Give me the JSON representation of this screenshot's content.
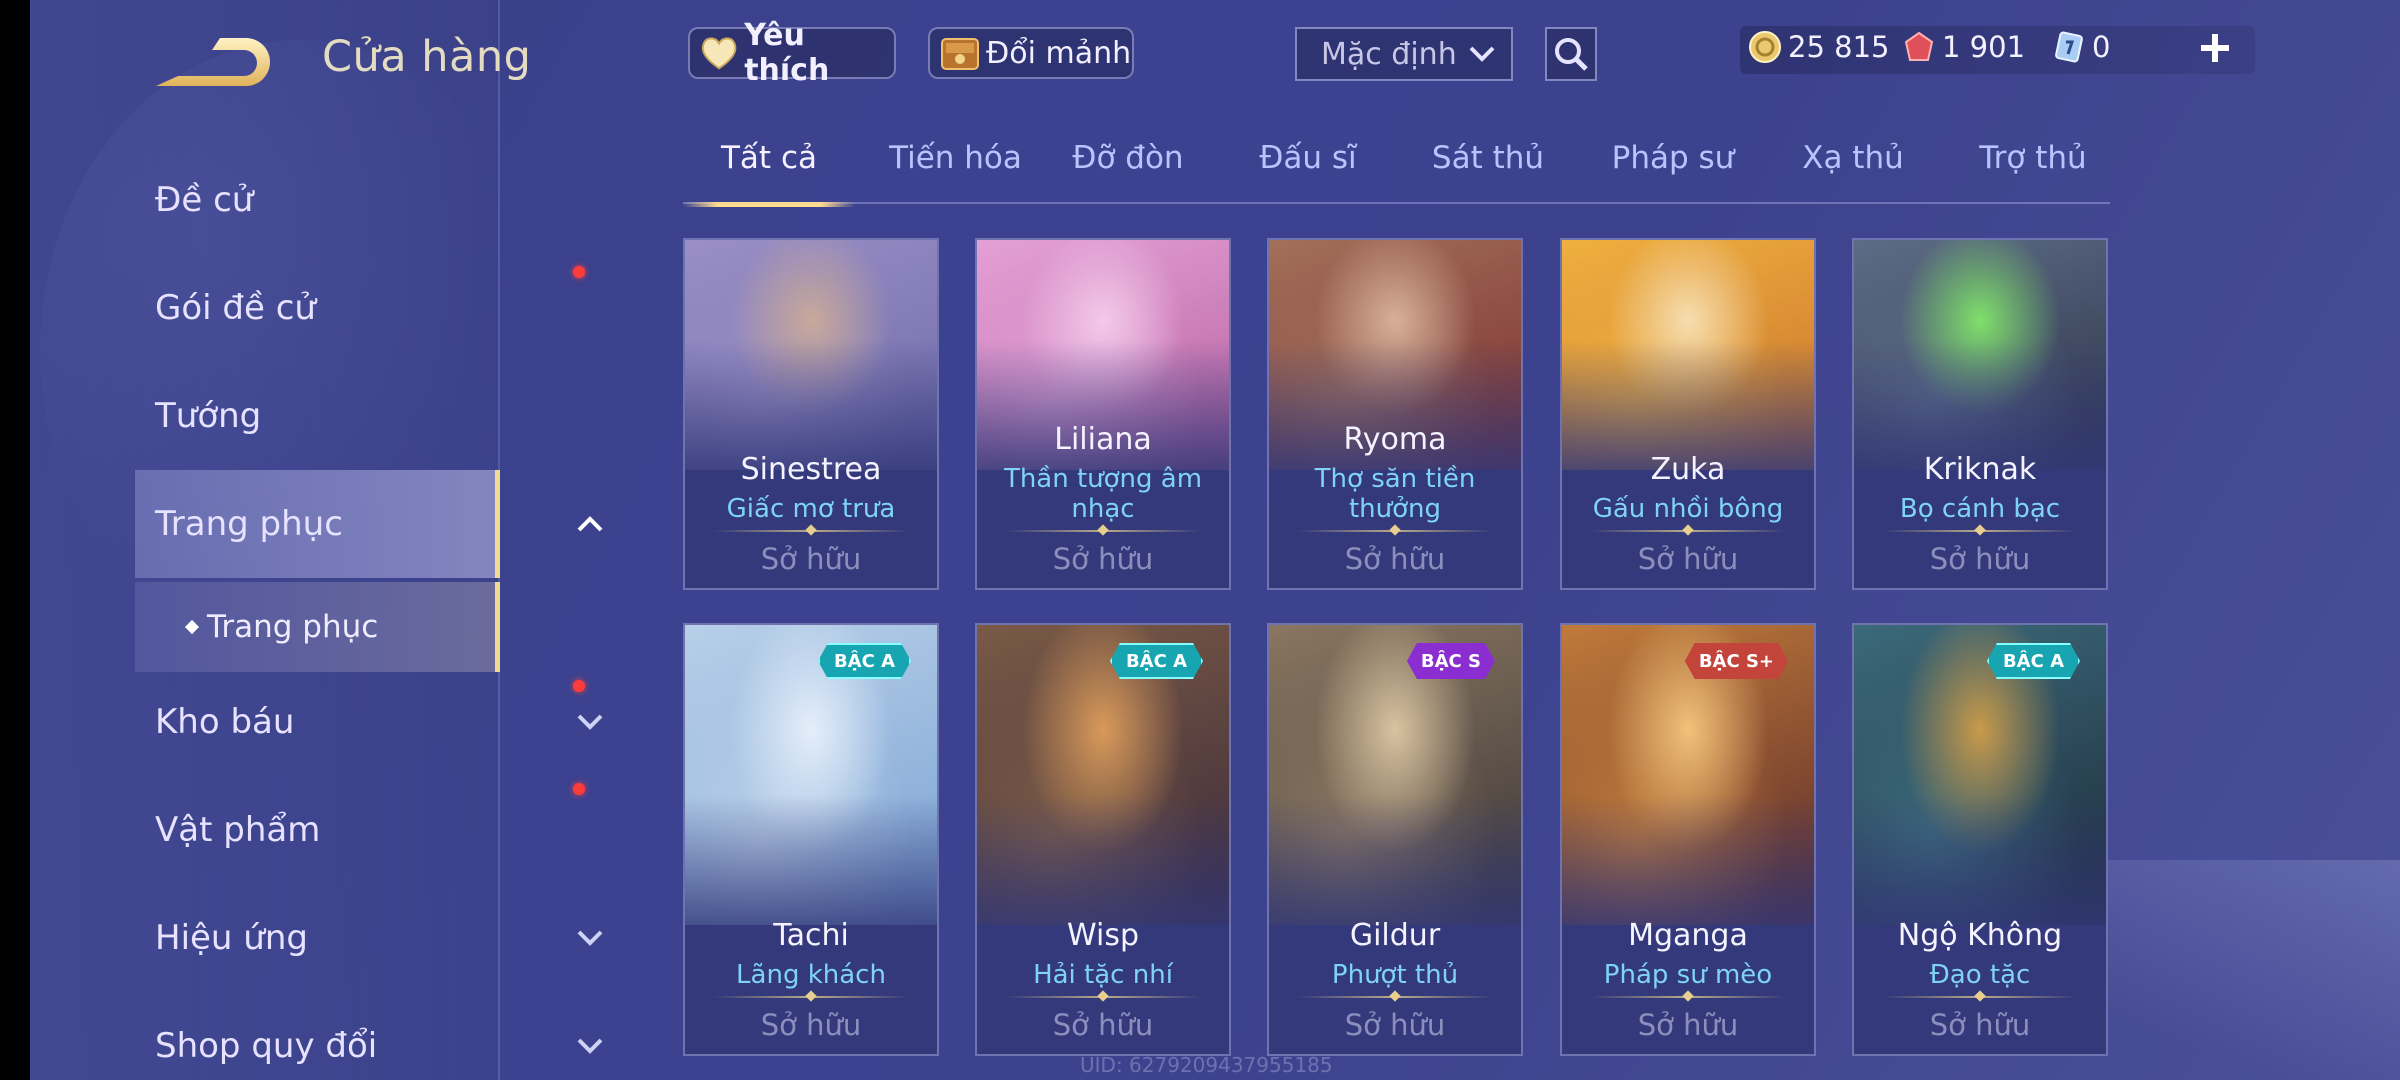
{
  "header": {
    "title": "Cửa hàng",
    "favorite_label": "Yêu thích",
    "exchange_label": "Đổi mảnh",
    "sort_value": "Mặc định"
  },
  "currencies": {
    "gold": "25 815",
    "ruby": "1 901",
    "tickets": "0"
  },
  "sidebar": {
    "items": [
      {
        "label": "Đề cử"
      },
      {
        "label": "Gói đề cử"
      },
      {
        "label": "Tướng"
      },
      {
        "label": "Trang phục"
      },
      {
        "label": "Kho báu"
      },
      {
        "label": "Vật phẩm"
      },
      {
        "label": "Hiệu ứng"
      },
      {
        "label": "Shop quy đổi"
      }
    ],
    "sub_item": "Trang phục"
  },
  "tabs": [
    "Tất cả",
    "Tiến hóa",
    "Đỡ đòn",
    "Đấu sĩ",
    "Sát thủ",
    "Pháp sư",
    "Xạ thủ",
    "Trợ thủ"
  ],
  "cards": [
    {
      "hero": "Sinestrea",
      "skin": "Giấc mơ trưa",
      "status": "Sở hữu",
      "badge": "",
      "colors": [
        "#9a8fc6",
        "#6d6aa8",
        "#c9a99a"
      ]
    },
    {
      "hero": "Liliana",
      "skin": "Thần tượng âm nhạc",
      "status": "Sở hữu",
      "badge": "",
      "colors": [
        "#e4a1d6",
        "#b6609e",
        "#f3c9ea"
      ]
    },
    {
      "hero": "Ryoma",
      "skin": "Thợ săn tiền thưởng",
      "status": "Sở hữu",
      "badge": "",
      "colors": [
        "#a2705a",
        "#7c2e2e",
        "#d7b09a"
      ]
    },
    {
      "hero": "Zuka",
      "skin": "Gấu nhồi bông",
      "status": "Sở hữu",
      "badge": "",
      "colors": [
        "#f0b040",
        "#c8722a",
        "#f6deb0"
      ]
    },
    {
      "hero": "Kriknak",
      "skin": "Bọ cánh bạc",
      "status": "Sở hữu",
      "badge": "",
      "colors": [
        "#5d6c86",
        "#2c3448",
        "#7fe06a"
      ]
    },
    {
      "hero": "Tachi",
      "skin": "Lãng khách",
      "status": "Sở hữu",
      "badge": "BẬC A",
      "colors": [
        "#b8cfe8",
        "#7aa2d4",
        "#e4eefa"
      ]
    },
    {
      "hero": "Wisp",
      "skin": "Hải tặc nhí",
      "status": "Sở hữu",
      "badge": "BẬC A",
      "colors": [
        "#7a5a46",
        "#3c2a3a",
        "#d99a5a"
      ]
    },
    {
      "hero": "Gildur",
      "skin": "Phượt thủ",
      "status": "Sở hữu",
      "badge": "BẬC S",
      "colors": [
        "#8a7660",
        "#3a3638",
        "#d9c3a0"
      ]
    },
    {
      "hero": "Mganga",
      "skin": "Pháp sư mèo",
      "status": "Sở hữu",
      "badge": "BẬC S+",
      "colors": [
        "#c07a3a",
        "#5a2a2a",
        "#f2c27a"
      ]
    },
    {
      "hero": "Ngộ Không",
      "skin": "Đạo tặc",
      "status": "Sở hữu",
      "badge": "BẬC A",
      "colors": [
        "#3b6a7a",
        "#1e2a3a",
        "#c89a4a"
      ]
    }
  ],
  "footer": {
    "uid": "UID: 6279209437955185"
  },
  "accent_colors": {
    "gold_accent": "#ffdc91",
    "notification_dot": "#ff3c3c",
    "skin_name": "#7fd3f5"
  }
}
